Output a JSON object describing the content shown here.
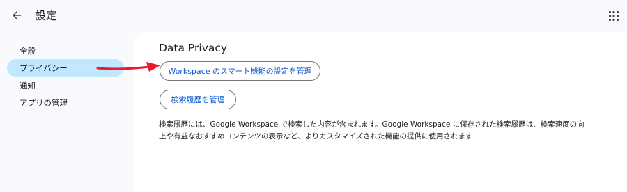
{
  "header": {
    "title": "設定",
    "back_icon": "arrow-left-icon",
    "apps_icon": "apps-grid-icon"
  },
  "sidebar": {
    "items": [
      {
        "label": "全般",
        "active": false
      },
      {
        "label": "プライバシー",
        "active": true
      },
      {
        "label": "通知",
        "active": false
      },
      {
        "label": "アプリの管理",
        "active": false
      }
    ]
  },
  "main": {
    "section_title": "Data Privacy",
    "workspace_button": "Workspace のスマート機能の設定を管理",
    "history_button": "検索履歴を管理",
    "description": "検索履歴には、Google Workspace で検索した内容が含まれます。Google Workspace に保存された検索履歴は、検索速度の向上や有益なおすすめコンテンツの表示など、よりカスタマイズされた機能の提供に使用されます"
  },
  "annotation": {
    "type": "red-arrow",
    "color": "#e8192c"
  },
  "colors": {
    "background": "#f8fafd",
    "active_nav": "#c2e7ff",
    "link_blue": "#0b57d0"
  }
}
